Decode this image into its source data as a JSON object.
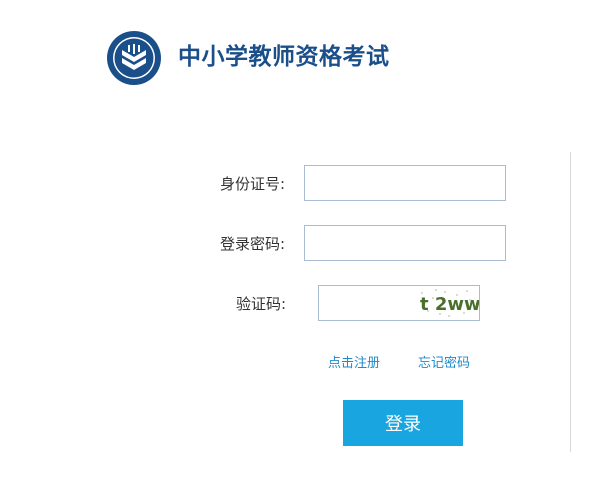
{
  "header": {
    "title": "中小学教师资格考试",
    "logo_icon": "book-shield-logo-icon"
  },
  "form": {
    "id_label": "身份证号:",
    "id_value": "",
    "password_label": "登录密码:",
    "password_value": "",
    "captcha_label": "验证码:",
    "captcha_value": "",
    "captcha_image_text": "t 2ww"
  },
  "links": {
    "register": "点击注册",
    "forgot_password": "忘记密码"
  },
  "buttons": {
    "login": "登录"
  },
  "colors": {
    "brand_title": "#1b4f8a",
    "link": "#1f8ac9",
    "button": "#19a6e0",
    "input_border": "#a9bcd3"
  }
}
